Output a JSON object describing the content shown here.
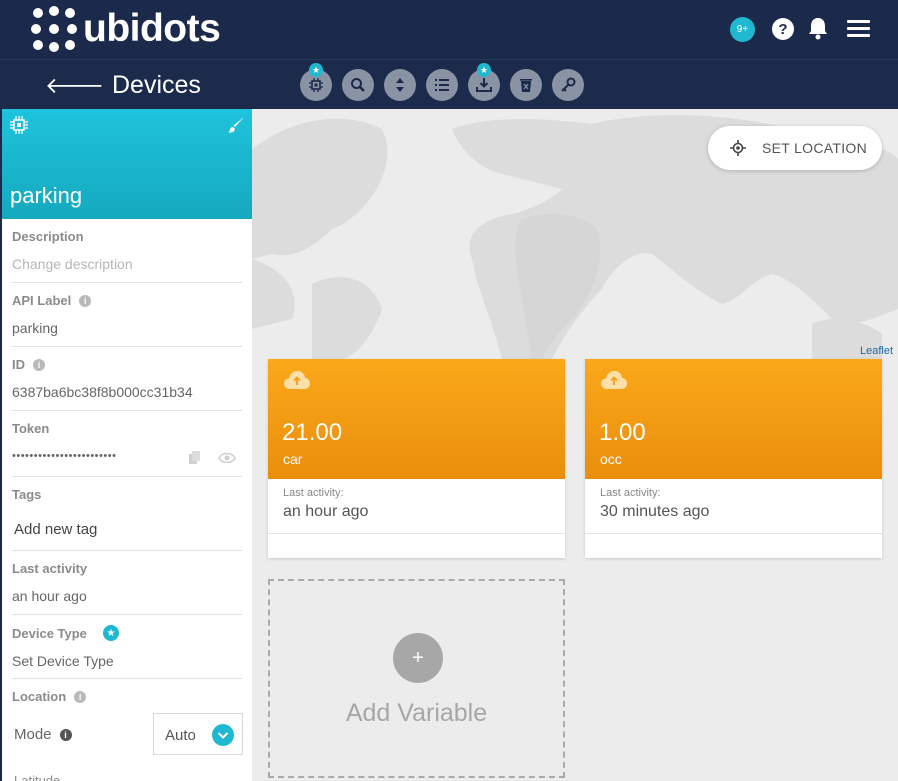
{
  "brand": {
    "name": "ubidots"
  },
  "header": {
    "notifications": "9+"
  },
  "subheader": {
    "title": "Devices"
  },
  "device": {
    "name": "parking",
    "fields": {
      "description_label": "Description",
      "description_placeholder": "Change description",
      "api_label_label": "API Label",
      "api_label_value": "parking",
      "id_label": "ID",
      "id_value": "6387ba6bc38f8b000cc31b34",
      "token_label": "Token",
      "token_value": "••••••••••••••••••••••••",
      "tags_label": "Tags",
      "tags_placeholder": "Add new tag",
      "last_activity_label": "Last activity",
      "last_activity_value": "an hour ago",
      "device_type_label": "Device Type",
      "device_type_value": "Set Device Type",
      "location_label": "Location",
      "mode_label": "Mode",
      "mode_value": "Auto",
      "latitude_label": "Latitude"
    }
  },
  "map": {
    "set_location": "SET LOCATION",
    "attribution": "Leaflet"
  },
  "variables": [
    {
      "value": "21.00",
      "name": "car",
      "last_activity_label": "Last activity:",
      "last_activity": "an hour ago"
    },
    {
      "value": "1.00",
      "name": "occ",
      "last_activity_label": "Last activity:",
      "last_activity": "30 minutes ago"
    }
  ],
  "add_variable": {
    "label": "Add Variable",
    "icon": "+"
  },
  "colors": {
    "topbar": "#1b2a4a",
    "accent": "#1fb8d0",
    "variable_card": "#f8a318"
  }
}
